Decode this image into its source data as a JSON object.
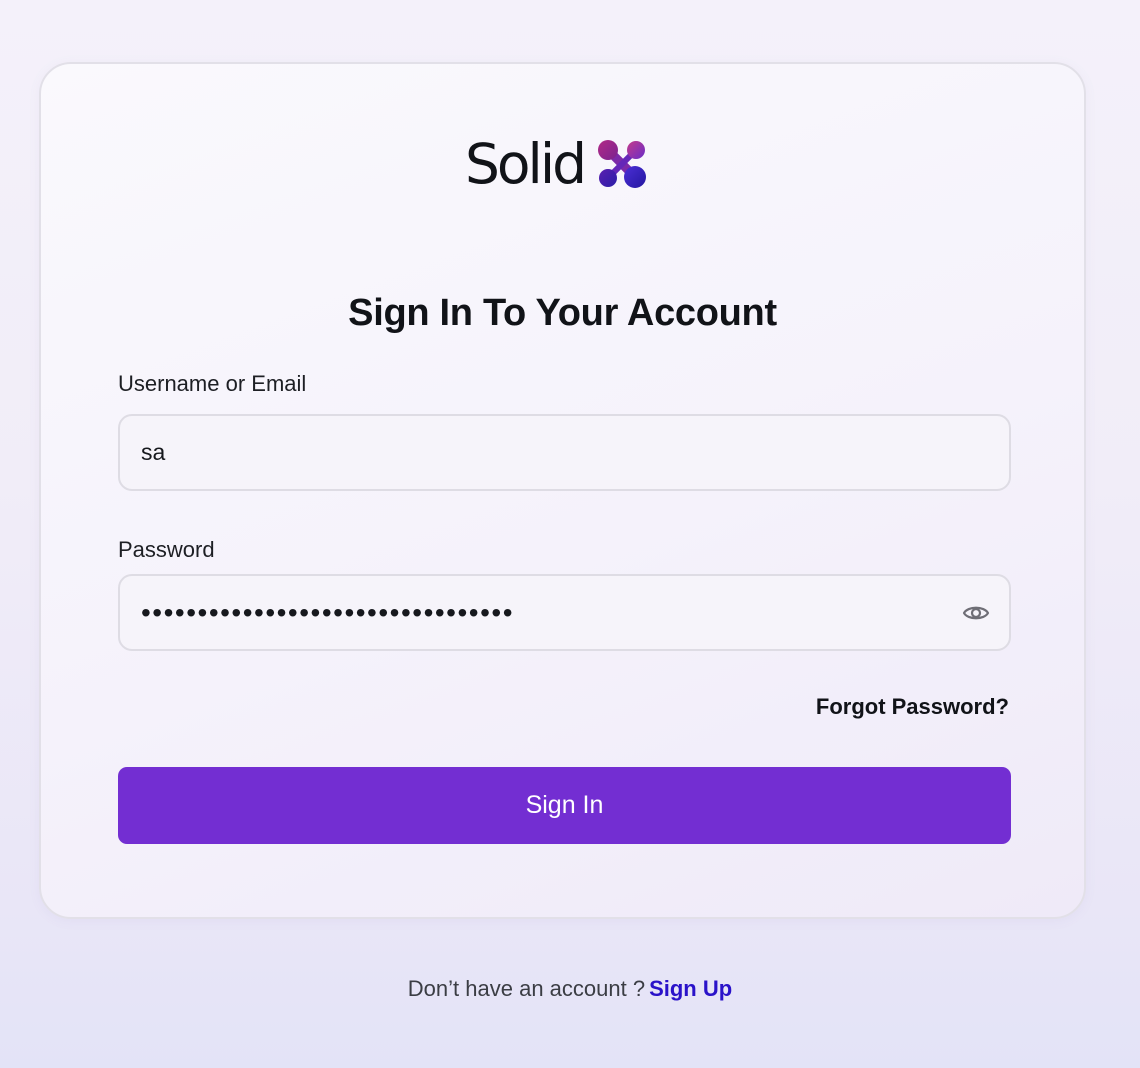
{
  "brand": {
    "name": "Solid",
    "logo_icon": "four-dot-cluster-icon",
    "logo_colors": [
      "#a3257f",
      "#5a1fb8",
      "#3a2fd0",
      "#6b2ad6"
    ]
  },
  "form": {
    "title": "Sign In To Your Account",
    "username": {
      "label": "Username or Email",
      "value": "sa"
    },
    "password": {
      "label": "Password",
      "masked_value": "•••••••••••••••••••••••••••••••••",
      "toggle_icon": "eye-icon"
    },
    "forgot_label": "Forgot Password?",
    "submit_label": "Sign In"
  },
  "footer": {
    "prompt": "Don’t have an account ?",
    "link": "Sign Up"
  },
  "colors": {
    "accent": "#732ed2",
    "link": "#2a12c9"
  }
}
